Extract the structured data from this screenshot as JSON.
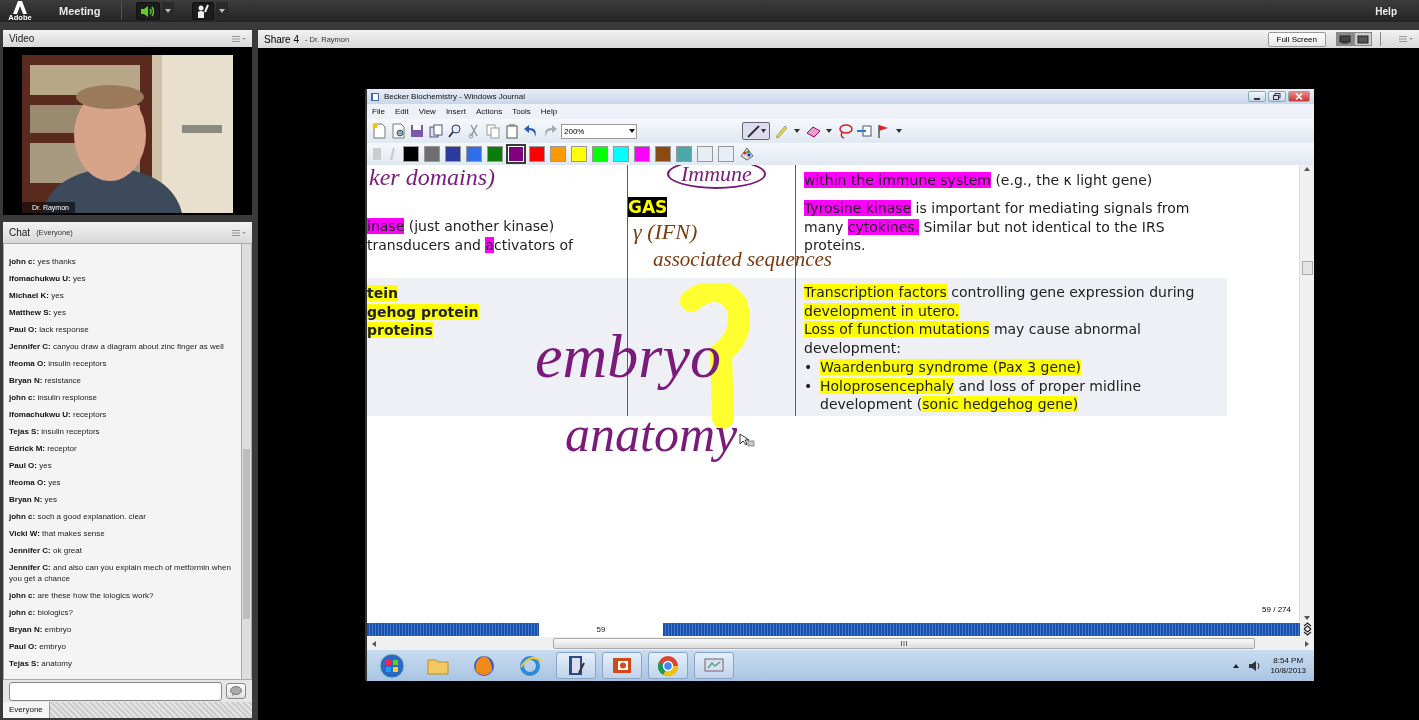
{
  "top_bar": {
    "logo_text": "Adobe",
    "menu": "Meeting",
    "speaker_on": true,
    "help": "Help"
  },
  "video_pod": {
    "title": "Video",
    "caption": "Dr. Raymon"
  },
  "chat": {
    "title": "Chat",
    "scope": "(Everyone)",
    "messages": [
      {
        "name": "john c:",
        "text": "yes thanks"
      },
      {
        "name": "Ifomachukwu U:",
        "text": "yes"
      },
      {
        "name": "Michael K:",
        "text": "yes"
      },
      {
        "name": "Matthew S:",
        "text": "yes"
      },
      {
        "name": "Paul O:",
        "text": "lack response"
      },
      {
        "name": "Jennifer C:",
        "text": "canyou draw a diagram about zinc finger as well"
      },
      {
        "name": "Ifeoma O:",
        "text": "insulin receptors"
      },
      {
        "name": "Bryan N:",
        "text": "resistance"
      },
      {
        "name": "john c:",
        "text": "insulin respionse"
      },
      {
        "name": "Ifomachukwu U:",
        "text": "receptors"
      },
      {
        "name": "Tejas S:",
        "text": "insulin receptors"
      },
      {
        "name": "Edrick M:",
        "text": "receptor"
      },
      {
        "name": "Paul O:",
        "text": "yes"
      },
      {
        "name": "Ifeoma O:",
        "text": "yes"
      },
      {
        "name": "Bryan N:",
        "text": "yes"
      },
      {
        "name": "john c:",
        "text": "soch a good explanation. clear"
      },
      {
        "name": "Vicki W:",
        "text": "that makes sense"
      },
      {
        "name": "Jennifer C:",
        "text": "ok great"
      },
      {
        "name": "Jennifer C:",
        "text": "and also can you explain mech of metformin when you get a chance"
      },
      {
        "name": "john c:",
        "text": "are these how the iologics work?"
      },
      {
        "name": "john c:",
        "text": "biologics?"
      },
      {
        "name": "Bryan N:",
        "text": "embryo"
      },
      {
        "name": "Paul O:",
        "text": "embryo"
      },
      {
        "name": "Tejas S:",
        "text": "anatomy"
      }
    ],
    "recipient": "Everyone"
  },
  "share_pod": {
    "title": "Share 4",
    "presenter": "- Dr. Raymon",
    "full_screen": "Full Screen"
  },
  "journal": {
    "title": "Becker Biochemistry - Windows Journal",
    "menu": [
      "File",
      "Edit",
      "View",
      "Insert",
      "Actions",
      "Tools",
      "Help"
    ],
    "zoom": "200%",
    "swatches": [
      {
        "color": "#000000",
        "selected": false
      },
      {
        "color": "#6e6e6e",
        "selected": false
      },
      {
        "color": "#2b3a9c",
        "selected": false
      },
      {
        "color": "#2f6fe8",
        "selected": false
      },
      {
        "color": "#0a7d0a",
        "selected": false
      },
      {
        "color": "#800080",
        "selected": true
      },
      {
        "color": "#ff0000",
        "selected": false
      },
      {
        "color": "#ff9900",
        "selected": false
      },
      {
        "color": "#ffff00",
        "selected": false
      },
      {
        "color": "#00ff00",
        "selected": false
      },
      {
        "color": "#00ffff",
        "selected": false
      },
      {
        "color": "#ff00ff",
        "selected": false
      },
      {
        "color": "#8b4a10",
        "selected": false
      },
      {
        "color": "#4aa8a8",
        "selected": false
      },
      {
        "color": "#e8eef6",
        "selected": false
      },
      {
        "color": "#e8eef6",
        "selected": false
      }
    ],
    "rows": [
      {
        "shaded": false,
        "column_3": [
          {
            "segments": [
              {
                "text": "within the immune system",
                "color": "#ff00ff"
              },
              {
                "text": " (e.g., the κ light gene)"
              }
            ]
          }
        ]
      },
      {
        "shaded": false,
        "column_1": [
          {
            "segments": [
              {
                "text": "inase",
                "color": "#ff00ff"
              },
              {
                "text": " (just another kinase)"
              }
            ]
          },
          {
            "segments": [
              {
                "text": "transducers and "
              },
              {
                "text": "a",
                "color": "#ff00ff"
              },
              {
                "text": "ctivators of"
              }
            ]
          }
        ],
        "column_2": [
          {
            "segments": [
              {
                "text": "GAS",
                "color": "#000000"
              }
            ]
          }
        ],
        "column_3": [
          {
            "segments": [
              {
                "text": "Tyrosine kinase",
                "color": "#ff00ff"
              },
              {
                "text": " is important for mediating signals from many "
              },
              {
                "text": "cytokines.",
                "color": "#ff00ff"
              },
              {
                "text": " Similar but not identical to the IRS proteins."
              }
            ]
          }
        ]
      },
      {
        "shaded": true,
        "bold_column_1": true,
        "column_1": [
          {
            "segments": [
              {
                "text": "tein",
                "color": "#ffff00"
              }
            ]
          },
          {
            "segments": [
              {
                "text": "gehog protein",
                "color": "#ffff00"
              }
            ]
          },
          {
            "segments": [
              {
                "text": " proteins",
                "color": "#ffff00"
              }
            ]
          }
        ],
        "column_3": [
          {
            "segments": [
              {
                "text": "Transcription factors",
                "color": "#ffff00"
              },
              {
                "text": " controlling gene expression during "
              },
              {
                "text": "development in utero.",
                "color": "#ffff00"
              }
            ]
          },
          {
            "segments": [
              {
                "text": "Loss of function mutations",
                "color": "#ffff00"
              },
              {
                "text": " may cause abnormal development:"
              }
            ]
          },
          {
            "bullet": "•",
            "segments": [
              {
                "text": "Waardenburg syndrome (Pax 3 gene)",
                "color": "#ffff00"
              }
            ]
          },
          {
            "bullet": "•",
            "segments": [
              {
                "text": "Holoprosencephaly",
                "color": "#ffff00"
              },
              {
                "text": " and loss of proper midline development ("
              },
              {
                "text": "sonic hedgehog gene)",
                "color": "#ffff00"
              }
            ]
          }
        ]
      }
    ],
    "ink": [
      {
        "text": "ker domains)",
        "color": "#7a1a7a"
      },
      {
        "text": "Immune",
        "color": "#7a1a7a"
      },
      {
        "text": "γ (IFN)",
        "color": "#7a3b10"
      },
      {
        "text": "associated sequences",
        "color": "#7a3b10"
      },
      {
        "text": "embryo",
        "color": "#7a1a7a"
      },
      {
        "text": "anatomy",
        "color": "#7a1a7a"
      }
    ],
    "page_count": "59 / 274",
    "page_number": "59"
  },
  "taskbar": {
    "time": "8:54 PM",
    "date": "10/8/2013"
  }
}
